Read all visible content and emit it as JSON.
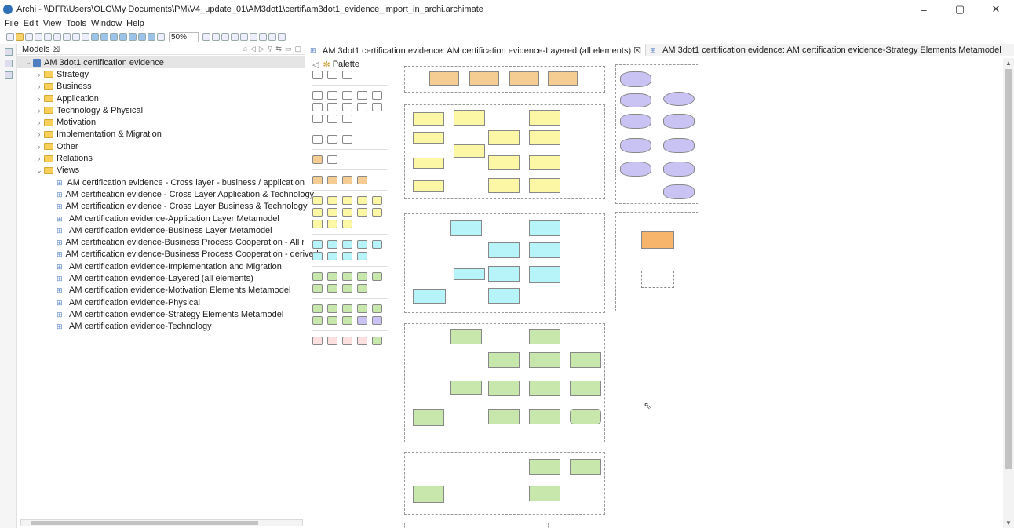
{
  "window": {
    "title": "Archi - \\\\DFR\\Users\\OLG\\My Documents\\PM\\V4_update_01\\AM3dot1\\certif\\am3dot1_evidence_import_in_archi.archimate",
    "minimize": "–",
    "maximize": "▢",
    "close": "✕"
  },
  "menu": [
    "File",
    "Edit",
    "View",
    "Tools",
    "Window",
    "Help"
  ],
  "toolbar": {
    "zoom": "50%"
  },
  "models_panel": {
    "title": "Models ☒",
    "root": "AM 3dot1 certification evidence",
    "folders": [
      "Strategy",
      "Business",
      "Application",
      "Technology & Physical",
      "Motivation",
      "Implementation & Migration",
      "Other",
      "Relations",
      "Views"
    ],
    "views": [
      "AM certification evidence - Cross layer - business / application",
      "AM certification evidence - Cross Layer Application & Technology",
      "AM certification evidence - Cross Layer Business & Technology",
      "AM certification evidence-Application Layer Metamodel",
      "AM certification evidence-Business Layer Metamodel",
      "AM certification evidence-Business Process Cooperation - All relatic",
      "AM certification evidence-Business Process Cooperation - derived",
      "AM certification evidence-Implementation and Migration",
      "AM certification evidence-Layered (all elements)",
      "AM certification evidence-Motivation Elements Metamodel",
      "AM certification evidence-Physical",
      "AM certification evidence-Strategy Elements Metamodel",
      "AM certification evidence-Technology"
    ]
  },
  "editor_tabs": [
    {
      "label": "AM 3dot1 certification evidence: AM certification evidence-Layered (all elements) ☒",
      "active": true
    },
    {
      "label": "AM 3dot1 certification evidence: AM certification evidence-Strategy Elements Metamodel",
      "active": false
    }
  ],
  "palette": {
    "title": "Palette"
  }
}
